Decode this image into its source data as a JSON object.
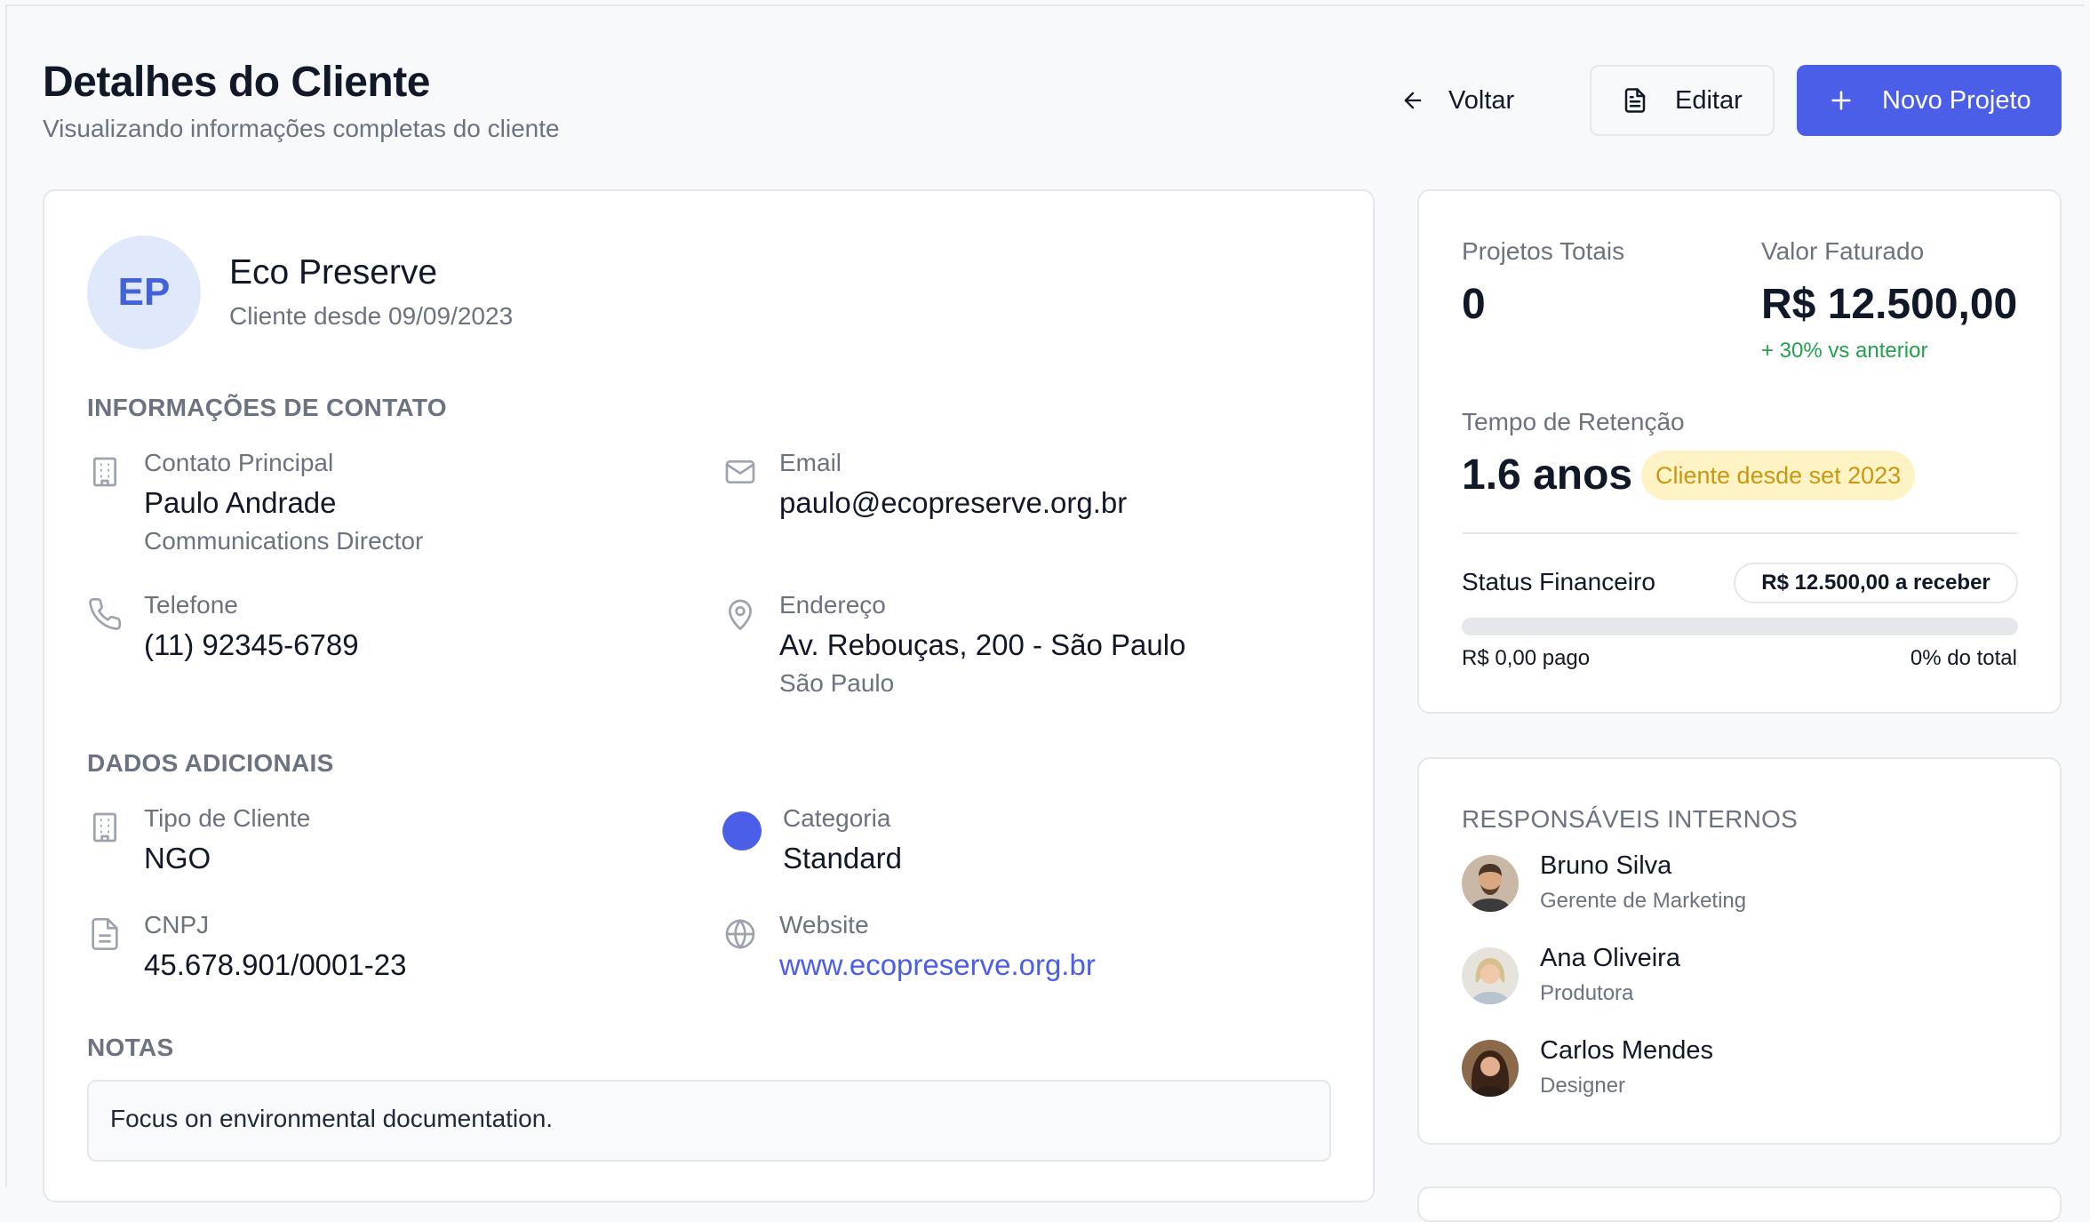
{
  "header": {
    "title": "Detalhes do Cliente",
    "subtitle": "Visualizando informações completas do cliente",
    "back_label": "Voltar",
    "edit_label": "Editar",
    "new_project_label": "Novo Projeto"
  },
  "client": {
    "initials": "EP",
    "name": "Eco Preserve",
    "since": "Cliente desde 09/09/2023"
  },
  "contact": {
    "section_title": "INFORMAÇÕES DE CONTATO",
    "main_contact_label": "Contato Principal",
    "main_contact_name": "Paulo Andrade",
    "main_contact_role": "Communications Director",
    "email_label": "Email",
    "email_value": "paulo@ecopreserve.org.br",
    "phone_label": "Telefone",
    "phone_value": "(11) 92345-6789",
    "address_label": "Endereço",
    "address_value": "Av. Rebouças, 200 - São Paulo",
    "address_city": "São Paulo"
  },
  "additional": {
    "section_title": "DADOS ADICIONAIS",
    "type_label": "Tipo de Cliente",
    "type_value": "NGO",
    "category_label": "Categoria",
    "category_value": "Standard",
    "category_color": "#4a5ee8",
    "cnpj_label": "CNPJ",
    "cnpj_value": "45.678.901/0001-23",
    "website_label": "Website",
    "website_value": "www.ecopreserve.org.br"
  },
  "notes": {
    "section_title": "NOTAS",
    "text": "Focus on environmental documentation."
  },
  "stats": {
    "projects_label": "Projetos Totais",
    "projects_value": "0",
    "billed_label": "Valor Faturado",
    "billed_value": "R$ 12.500,00",
    "billed_delta": "+ 30% vs anterior",
    "retention_label": "Tempo de Retenção",
    "retention_value": "1.6 anos",
    "retention_badge": "Cliente desde set 2023",
    "financial_title": "Status Financeiro",
    "receivable_badge": "R$ 12.500,00 a receber",
    "paid_text": "R$ 0,00 pago",
    "percent_text": "0% do total",
    "paid_fraction": 0
  },
  "team": {
    "title": "RESPONSÁVEIS INTERNOS",
    "members": [
      {
        "name": "Bruno Silva",
        "role": "Gerente de Marketing"
      },
      {
        "name": "Ana Oliveira",
        "role": "Produtora"
      },
      {
        "name": "Carlos Mendes",
        "role": "Designer"
      }
    ]
  },
  "colors": {
    "accent": "#4a5ee8",
    "positive": "#22a04b",
    "badge_bg": "#fdf3c4",
    "badge_text": "#c99812"
  }
}
